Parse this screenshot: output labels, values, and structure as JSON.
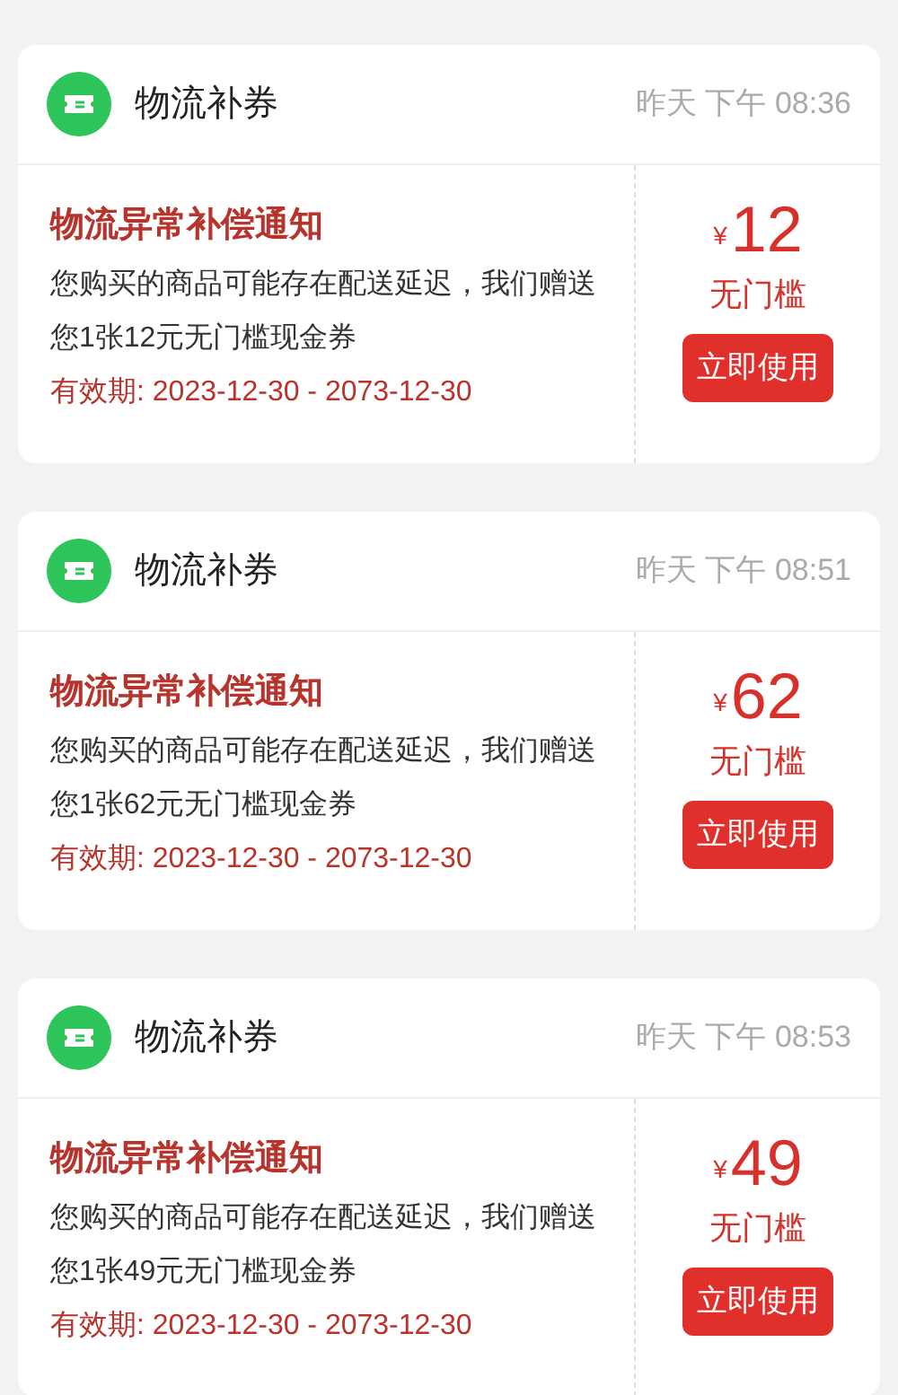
{
  "coupons": [
    {
      "category": "物流补券",
      "time": "昨天 下午 08:36",
      "title": "物流异常补偿通知",
      "description": "您购买的商品可能存在配送延迟，我们赠送您1张12元无门槛现金券",
      "validity": "有效期: 2023-12-30 - 2073-12-30",
      "currency": "¥",
      "amount": "12",
      "condition": "无门槛",
      "button": "立即使用"
    },
    {
      "category": "物流补券",
      "time": "昨天 下午 08:51",
      "title": "物流异常补偿通知",
      "description": "您购买的商品可能存在配送延迟，我们赠送您1张62元无门槛现金券",
      "validity": "有效期: 2023-12-30 - 2073-12-30",
      "currency": "¥",
      "amount": "62",
      "condition": "无门槛",
      "button": "立即使用"
    },
    {
      "category": "物流补券",
      "time": "昨天 下午 08:53",
      "title": "物流异常补偿通知",
      "description": "您购买的商品可能存在配送延迟，我们赠送您1张49元无门槛现金券",
      "validity": "有效期: 2023-12-30 - 2073-12-30",
      "currency": "¥",
      "amount": "49",
      "condition": "无门槛",
      "button": "立即使用"
    }
  ]
}
